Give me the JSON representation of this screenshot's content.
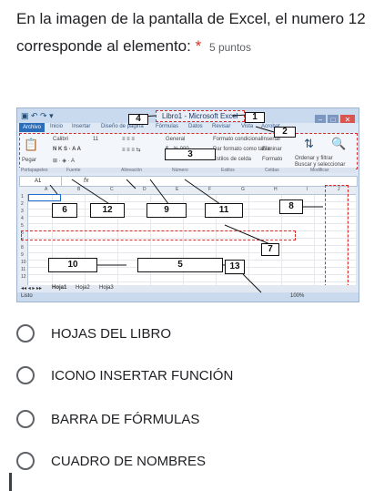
{
  "question": {
    "text": "En la imagen de la pantalla de Excel, el numero 12 corresponde al elemento:",
    "required_mark": "*",
    "points": "5 puntos"
  },
  "excel": {
    "title": "Libro1 - Microsoft Excel",
    "tabs": [
      "Archivo",
      "Inicio",
      "Insertar",
      "Diseño de página",
      "Fórmulas",
      "Datos",
      "Revisar",
      "Vista",
      "Acrobat"
    ],
    "ribbon": {
      "paste": "Pegar",
      "font_name": "Calibri",
      "font_size": "11",
      "number_format": "General",
      "cond_format": "Formato condicional",
      "table_format": "Dar formato como tabla",
      "cell_styles": "Estilos de celda",
      "insert": "Insertar",
      "delete": "Eliminar",
      "format": "Formato",
      "sort_filter": "Ordenar y filtrar",
      "find_select": "Buscar y seleccionar",
      "groups": [
        "Portapapeles",
        "Fuente",
        "Alineación",
        "Número",
        "Estilos",
        "Celdas",
        "Modificar"
      ]
    },
    "name_box": "A1",
    "fx_label": "fx",
    "columns": [
      "A",
      "B",
      "C",
      "D",
      "E",
      "F",
      "G",
      "H",
      "I",
      "J"
    ],
    "rows": [
      "1",
      "2",
      "3",
      "4",
      "5",
      "6",
      "7",
      "8",
      "9",
      "10",
      "11",
      "12"
    ],
    "sheets": [
      "Hoja1",
      "Hoja2",
      "Hoja3"
    ],
    "status": "Listo",
    "zoom": "100%",
    "callouts": [
      "1",
      "2",
      "3",
      "4",
      "5",
      "6",
      "7",
      "8",
      "9",
      "10",
      "11",
      "12",
      "13"
    ]
  },
  "options": [
    "HOJAS DEL LIBRO",
    "ICONO INSERTAR FUNCIÓN",
    "BARRA DE FÓRMULAS",
    "CUADRO DE NOMBRES"
  ],
  "colors": {
    "accent_red": "#d62b2b",
    "excel_blue": "#2a6ebb",
    "required": "#d93025"
  }
}
